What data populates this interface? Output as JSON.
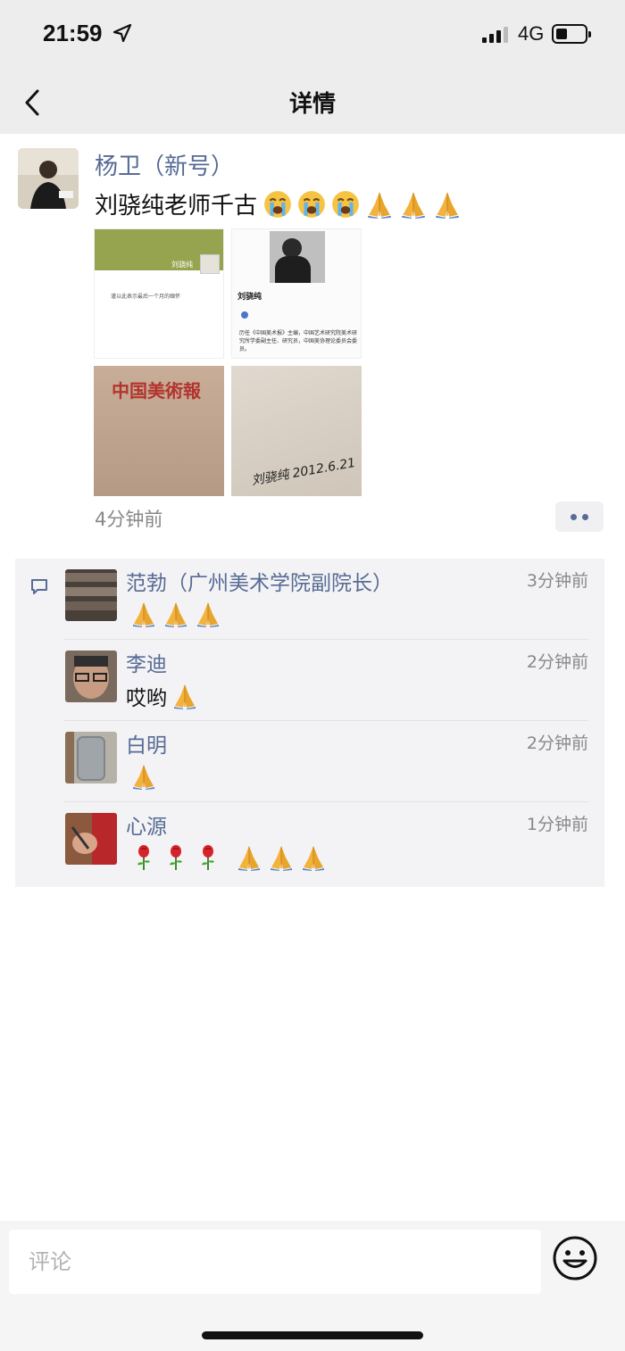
{
  "status_bar": {
    "time": "21:59",
    "network": "4G"
  },
  "nav": {
    "title": "详情"
  },
  "post": {
    "author": "杨卫（新号）",
    "text": "刘骁纯老师千古",
    "emojis": [
      "crying-face",
      "crying-face",
      "crying-face",
      "folded-hands",
      "folded-hands",
      "folded-hands"
    ],
    "images": [
      {
        "caption": "刘骁纯",
        "subtitle": "谨以此表示最后一个月的缅怀"
      },
      {
        "caption": "刘骁纯",
        "body": "历任《中国美术报》主编，中国艺术研究院美术研究所学委副主任、研究员，中国美协理论委员会委员。"
      },
      {
        "caption": "中国美術報"
      },
      {
        "caption": "刘骁纯 2012.6.21"
      }
    ],
    "time": "4分钟前"
  },
  "comments": [
    {
      "name": "范勃（广州美术学院副院长）",
      "time": "3分钟前",
      "text": "",
      "emojis": [
        "folded-hands",
        "folded-hands",
        "folded-hands"
      ]
    },
    {
      "name": "李迪",
      "time": "2分钟前",
      "text": "哎哟",
      "emojis": [
        "folded-hands"
      ]
    },
    {
      "name": "白明",
      "time": "2分钟前",
      "text": "",
      "emojis": [
        "folded-hands"
      ]
    },
    {
      "name": "心源",
      "time": "1分钟前",
      "text": "",
      "emojis": [
        "rose",
        "rose",
        "rose",
        "folded-hands",
        "folded-hands",
        "folded-hands"
      ]
    }
  ],
  "input": {
    "placeholder": "评论"
  },
  "colors": {
    "link": "#576b95",
    "background": "#ededed",
    "comment_bg": "#f3f3f5"
  }
}
